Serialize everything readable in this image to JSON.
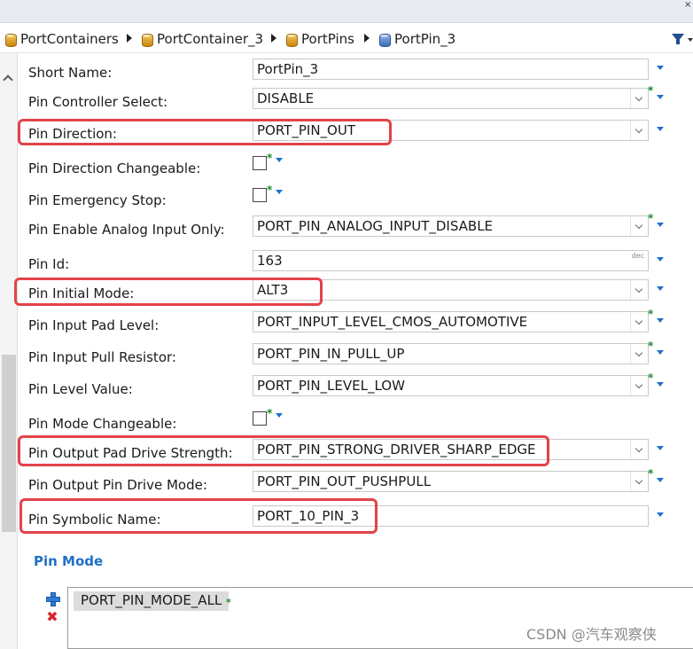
{
  "breadcrumb": {
    "items": [
      {
        "label": "PortContainers"
      },
      {
        "label": "PortContainer_3"
      },
      {
        "label": "PortPins"
      },
      {
        "label": "PortPin_3"
      }
    ]
  },
  "form": {
    "short_name": {
      "label": "Short Name:",
      "value": "PortPin_3"
    },
    "pin_controller_select": {
      "label": "Pin Controller Select:",
      "value": "DISABLE"
    },
    "pin_direction": {
      "label": "Pin Direction:",
      "value": "PORT_PIN_OUT"
    },
    "pin_direction_changeable": {
      "label": "Pin Direction Changeable:",
      "checked": false
    },
    "pin_emergency_stop": {
      "label": "Pin Emergency Stop:",
      "checked": false
    },
    "pin_enable_analog_input_only": {
      "label": "Pin Enable Analog Input Only:",
      "value": "PORT_PIN_ANALOG_INPUT_DISABLE"
    },
    "pin_id": {
      "label": "Pin Id:",
      "value": "163",
      "unit": "dec"
    },
    "pin_initial_mode": {
      "label": "Pin Initial Mode:",
      "value": "ALT3"
    },
    "pin_input_pad_level": {
      "label": "Pin Input Pad Level:",
      "value": "PORT_INPUT_LEVEL_CMOS_AUTOMOTIVE"
    },
    "pin_input_pull_resistor": {
      "label": "Pin Input Pull Resistor:",
      "value": "PORT_PIN_IN_PULL_UP"
    },
    "pin_level_value": {
      "label": "Pin Level Value:",
      "value": "PORT_PIN_LEVEL_LOW"
    },
    "pin_mode_changeable": {
      "label": "Pin Mode Changeable:",
      "checked": false
    },
    "pin_output_pad_drive_strength": {
      "label": "Pin Output Pad Drive Strength:",
      "value": "PORT_PIN_STRONG_DRIVER_SHARP_EDGE"
    },
    "pin_output_pin_drive_mode": {
      "label": "Pin Output Pin Drive Mode:",
      "value": "PORT_PIN_OUT_PUSHPULL"
    },
    "pin_symbolic_name": {
      "label": "Pin Symbolic Name:",
      "value": "PORT_10_PIN_3"
    }
  },
  "pin_mode": {
    "title": "Pin Mode",
    "items": [
      "PORT_PIN_MODE_ALL"
    ]
  },
  "markers": {
    "star": "*",
    "delete": "✖",
    "close": "×"
  },
  "watermark": "CSDN @汽车观察侠",
  "colors": {
    "highlight": "#e2434b",
    "accent": "#1f6fc6",
    "star": "#1a8a2a"
  }
}
